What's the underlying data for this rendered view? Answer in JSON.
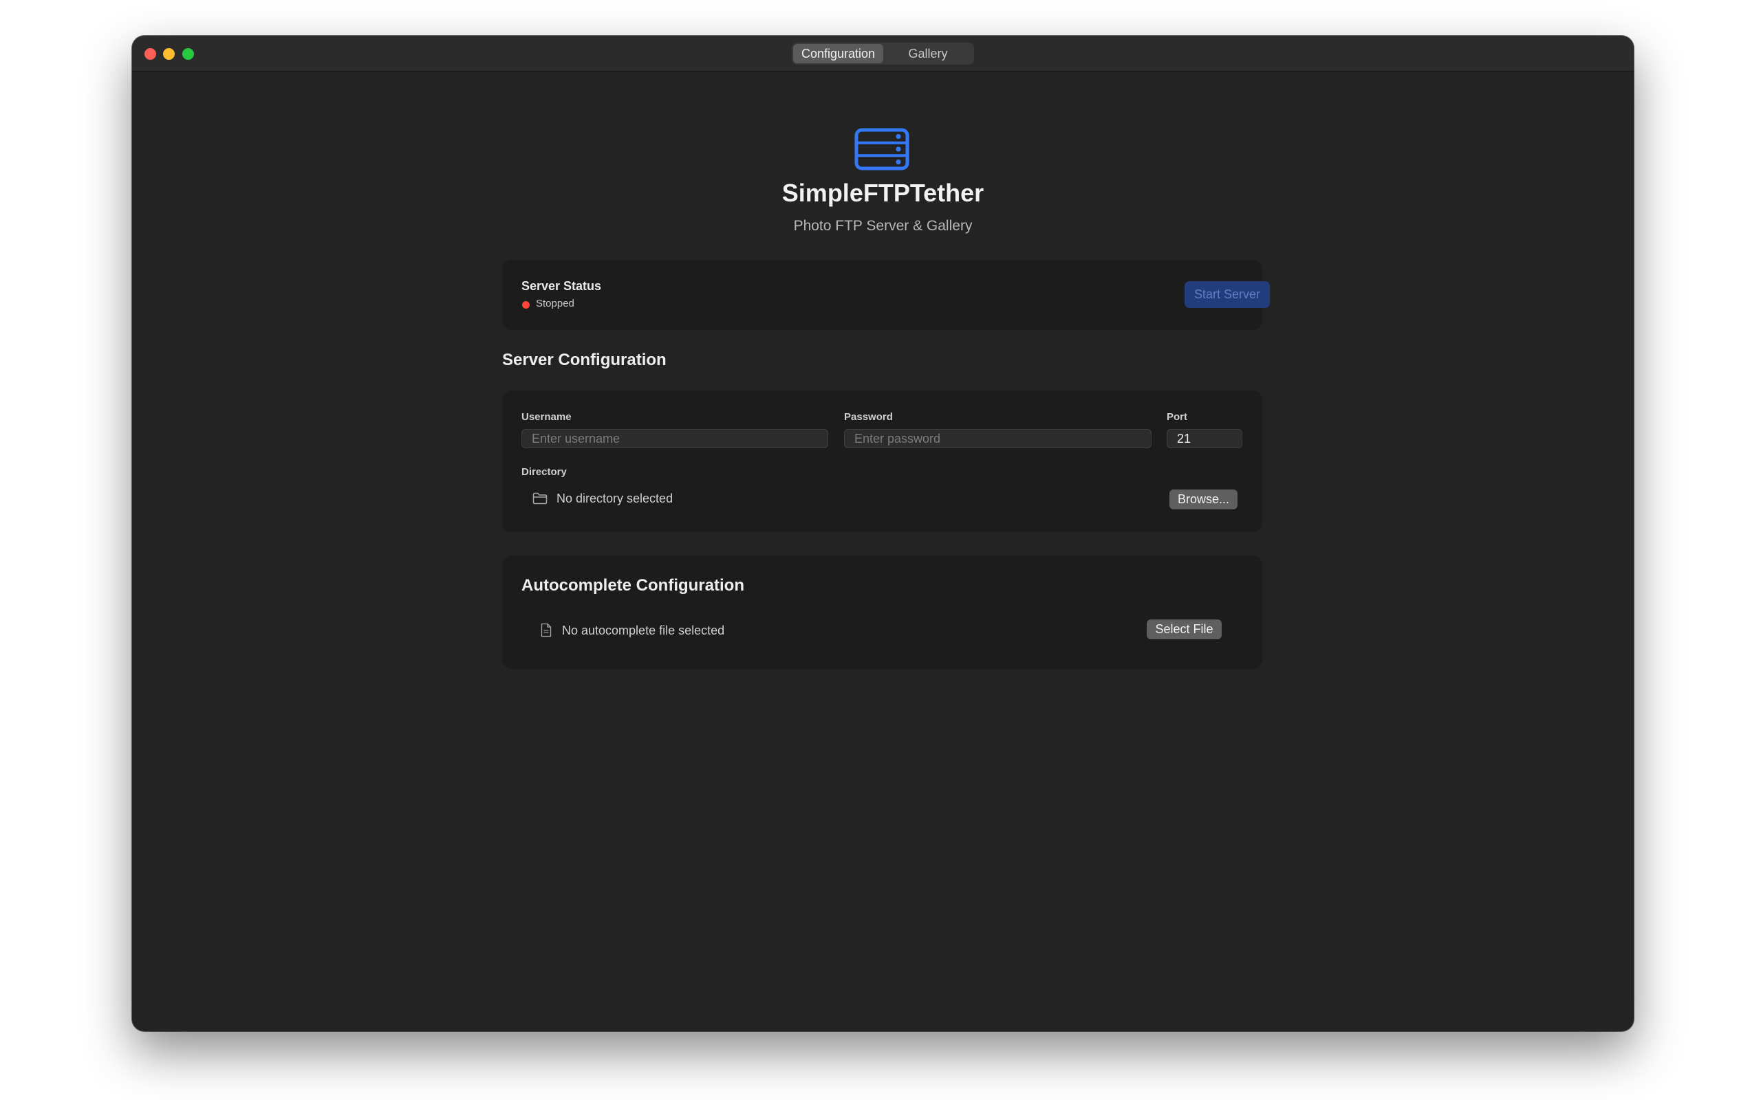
{
  "toolbar": {
    "tabs": [
      {
        "label": "Configuration",
        "selected": true
      },
      {
        "label": "Gallery",
        "selected": false
      }
    ]
  },
  "header": {
    "icon": "server-rack-icon",
    "title": "SimpleFTPTether",
    "subtitle": "Photo FTP Server & Gallery"
  },
  "server_status": {
    "title": "Server Status",
    "state": "Stopped",
    "state_color": "#ff453a",
    "start_button_label": "Start Server"
  },
  "server_config": {
    "heading": "Server Configuration",
    "username_label": "Username",
    "username_placeholder": "Enter username",
    "password_label": "Password",
    "password_placeholder": "Enter password",
    "port_label": "Port",
    "port_value": "21",
    "directory_label": "Directory",
    "directory_icon": "folder-icon",
    "directory_value": "No directory selected",
    "browse_button_label": "Browse..."
  },
  "autocomplete_config": {
    "heading": "Autocomplete Configuration",
    "file_icon": "document-icon",
    "file_value": "No autocomplete file selected",
    "select_button_label": "Select File"
  },
  "colors": {
    "accent": "#3478f6",
    "window_background": "#232323",
    "card_background": "#1c1c1c"
  }
}
